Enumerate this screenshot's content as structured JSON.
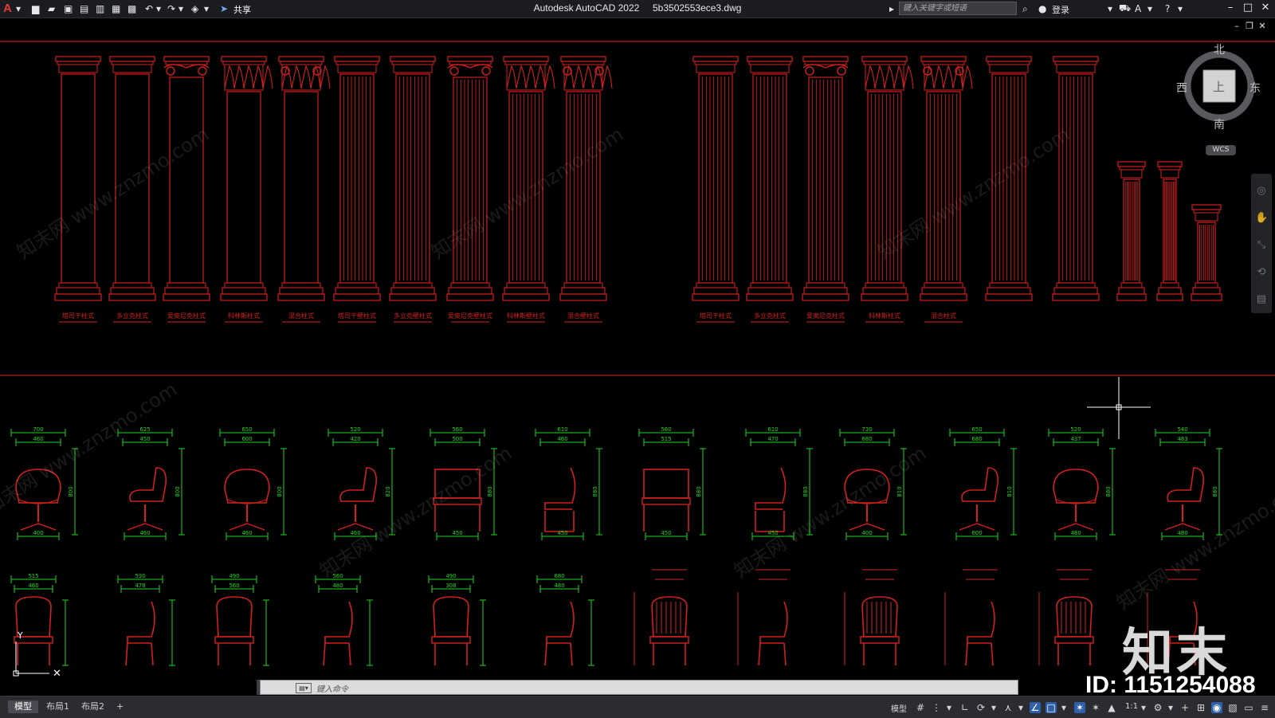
{
  "titlebar": {
    "app_name": "Autodesk AutoCAD 2022",
    "file_name": "5b3502553ece3.dwg",
    "share": "共享",
    "search_placeholder": "键入关键字或短语",
    "login": "登录"
  },
  "viewcube": {
    "north": "北",
    "south": "南",
    "east": "东",
    "west": "西",
    "face": "上",
    "wcs": "WCS"
  },
  "column_labels_left": [
    "塔司干柱式",
    "多立克柱式",
    "爱奥尼克柱式",
    "科林斯柱式",
    "混合柱式",
    "塔司干壁柱式",
    "多立克壁柱式",
    "爱奥尼克壁柱式",
    "科林斯壁柱式",
    "混合壁柱式"
  ],
  "column_labels_right": [
    "塔司干柱式",
    "多立克柱式",
    "爱奥尼克柱式",
    "科林斯柱式",
    "混合柱式"
  ],
  "chair_dims_top": [
    {
      "w1": "700",
      "w2": "460",
      "h": "800",
      "d": "400"
    },
    {
      "w1": "625",
      "w2": "450",
      "h": "800",
      "d": "460"
    },
    {
      "w1": "650",
      "w2": "600",
      "h": "800",
      "d": "460"
    },
    {
      "w1": "520",
      "w2": "420",
      "h": "820",
      "d": "460"
    },
    {
      "w1": "560",
      "w2": "500",
      "h": "880",
      "d": "450"
    },
    {
      "w1": "610",
      "w2": "460",
      "h": "880",
      "d": "450"
    },
    {
      "w1": "560",
      "w2": "515",
      "h": "880",
      "d": "450"
    },
    {
      "w1": "610",
      "w2": "470",
      "h": "880",
      "d": "450"
    },
    {
      "w1": "730",
      "w2": "680",
      "h": "810",
      "d": "400"
    },
    {
      "w1": "650",
      "w2": "680",
      "h": "810",
      "d": "600"
    },
    {
      "w1": "520",
      "w2": "437",
      "h": "880",
      "d": "480"
    },
    {
      "w1": "540",
      "w2": "483",
      "h": "880",
      "d": "480"
    }
  ],
  "chair_dims_bottom": [
    {
      "w1": "515",
      "w2": "460"
    },
    {
      "w1": "530",
      "w2": "478"
    },
    {
      "w1": "490",
      "w2": "560"
    },
    {
      "w1": "560",
      "w2": "480"
    },
    {
      "w1": "490",
      "w2": "308"
    },
    {
      "w1": "680",
      "w2": "480"
    }
  ],
  "watermark": "知末网 www.znzmo.com",
  "brand": "知末",
  "id_text": "ID: 1151254088",
  "command": {
    "placeholder": "键入命令"
  },
  "tabs": [
    "模型",
    "布局1",
    "布局2",
    "+"
  ],
  "status": {
    "model": "模型",
    "scale": "1:1"
  }
}
